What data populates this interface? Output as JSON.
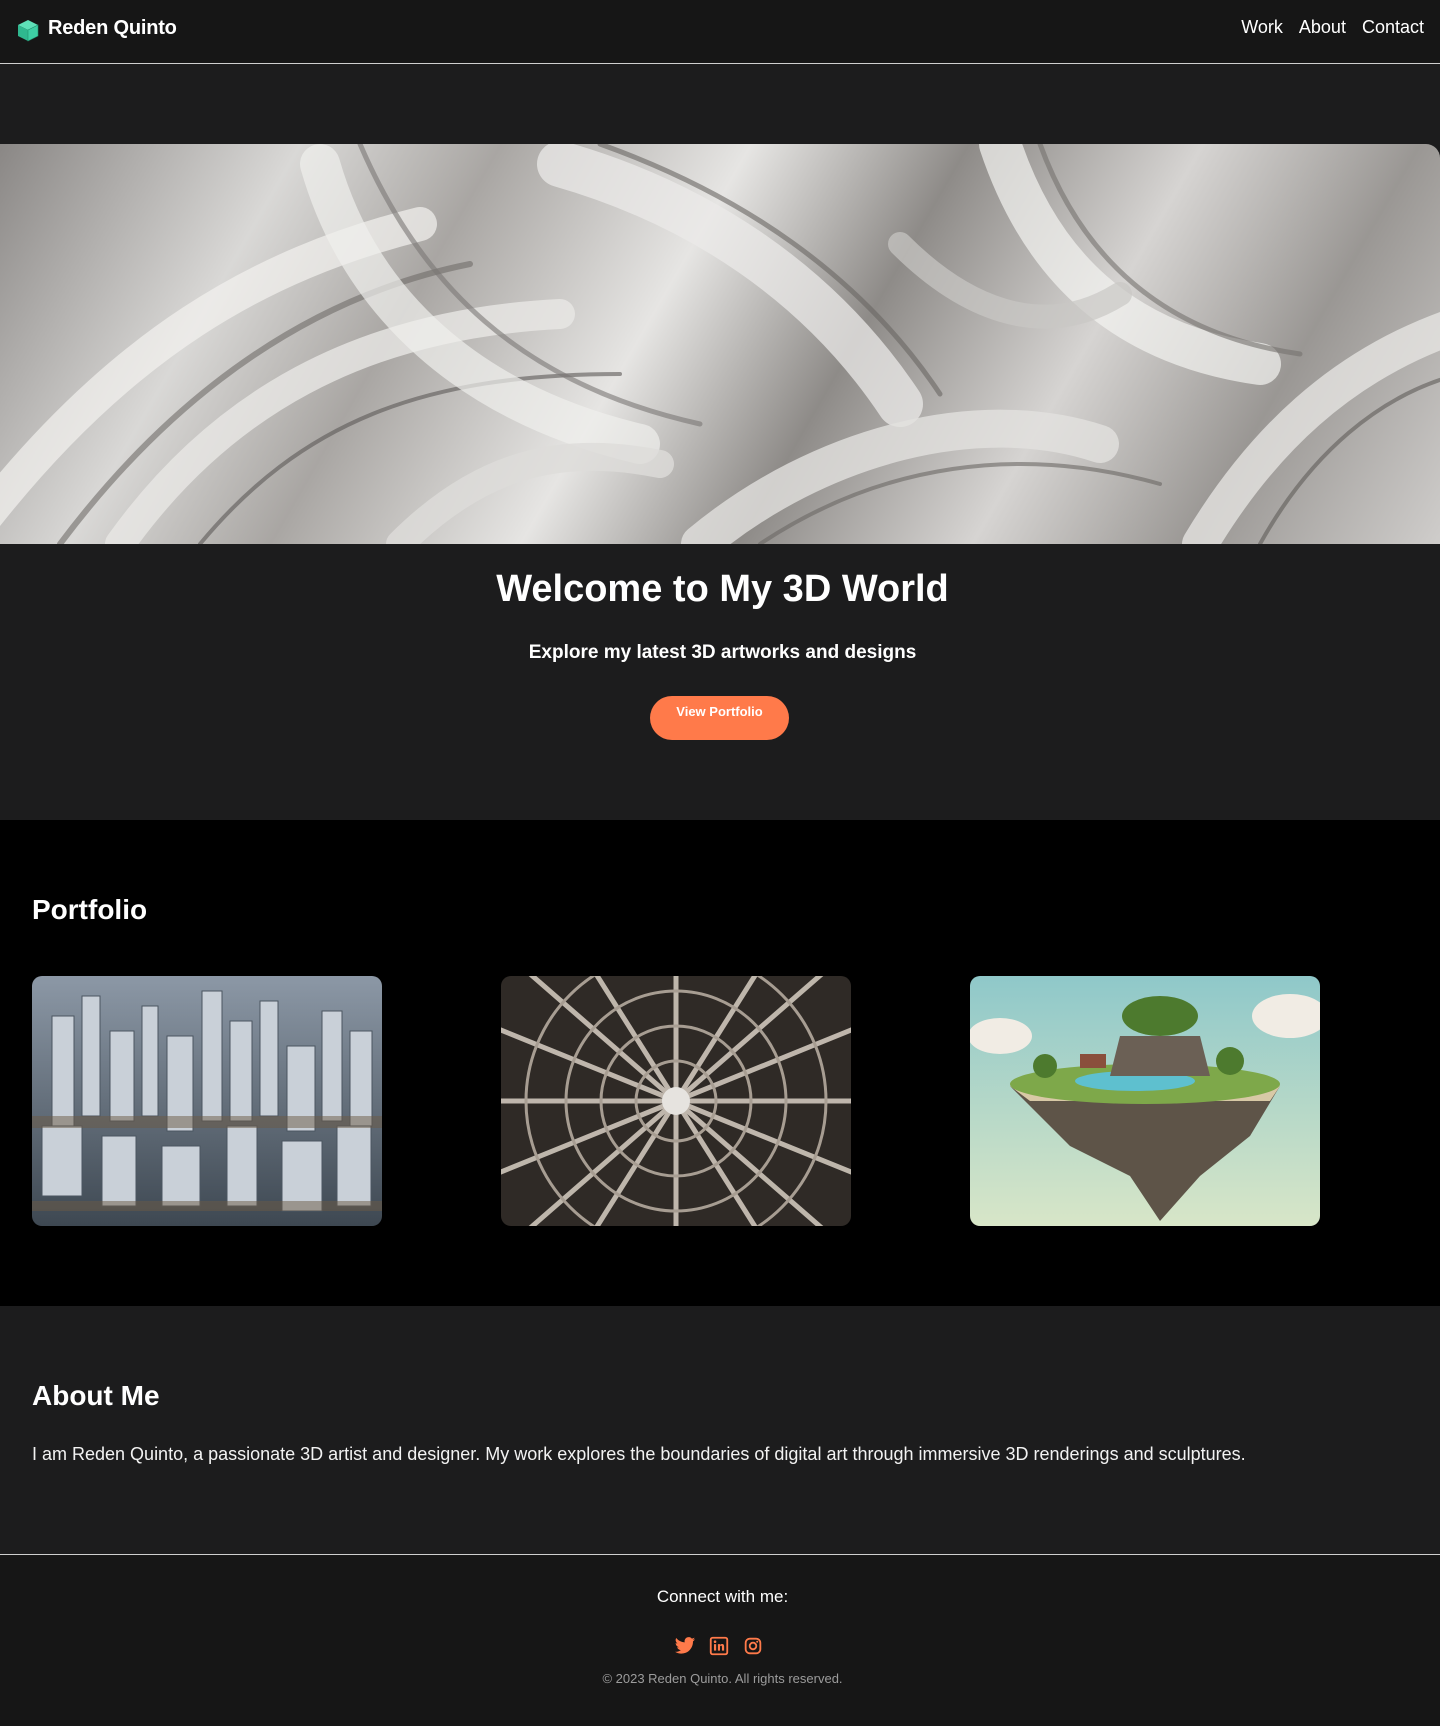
{
  "header": {
    "brand_name": "Reden Quinto",
    "brand_icon": "cube-icon",
    "nav": [
      {
        "label": "Work"
      },
      {
        "label": "About"
      },
      {
        "label": "Contact"
      }
    ]
  },
  "hero": {
    "title": "Welcome to My 3D World",
    "subtitle": "Explore my latest 3D artworks and designs",
    "button_label": "View Portfolio"
  },
  "portfolio": {
    "title": "Portfolio",
    "items": [
      {
        "image": "futuristic-city-render"
      },
      {
        "image": "radial-lattice-sculpture"
      },
      {
        "image": "floating-island-render"
      }
    ]
  },
  "about": {
    "title": "About Me",
    "text": "I am Reden Quinto, a passionate 3D artist and designer. My work explores the boundaries of digital art through immersive 3D renderings and sculptures."
  },
  "footer": {
    "connect_label": "Connect with me:",
    "socials": [
      {
        "icon": "twitter-icon"
      },
      {
        "icon": "linkedin-icon"
      },
      {
        "icon": "instagram-icon"
      }
    ],
    "copyright": "© 2023 Reden Quinto. All rights reserved."
  },
  "colors": {
    "accent": "#ff7a4a",
    "brand_icon": "#3ecfa4",
    "header_bg": "#161616",
    "section_bg": "#1c1c1d",
    "portfolio_bg": "#000000"
  }
}
